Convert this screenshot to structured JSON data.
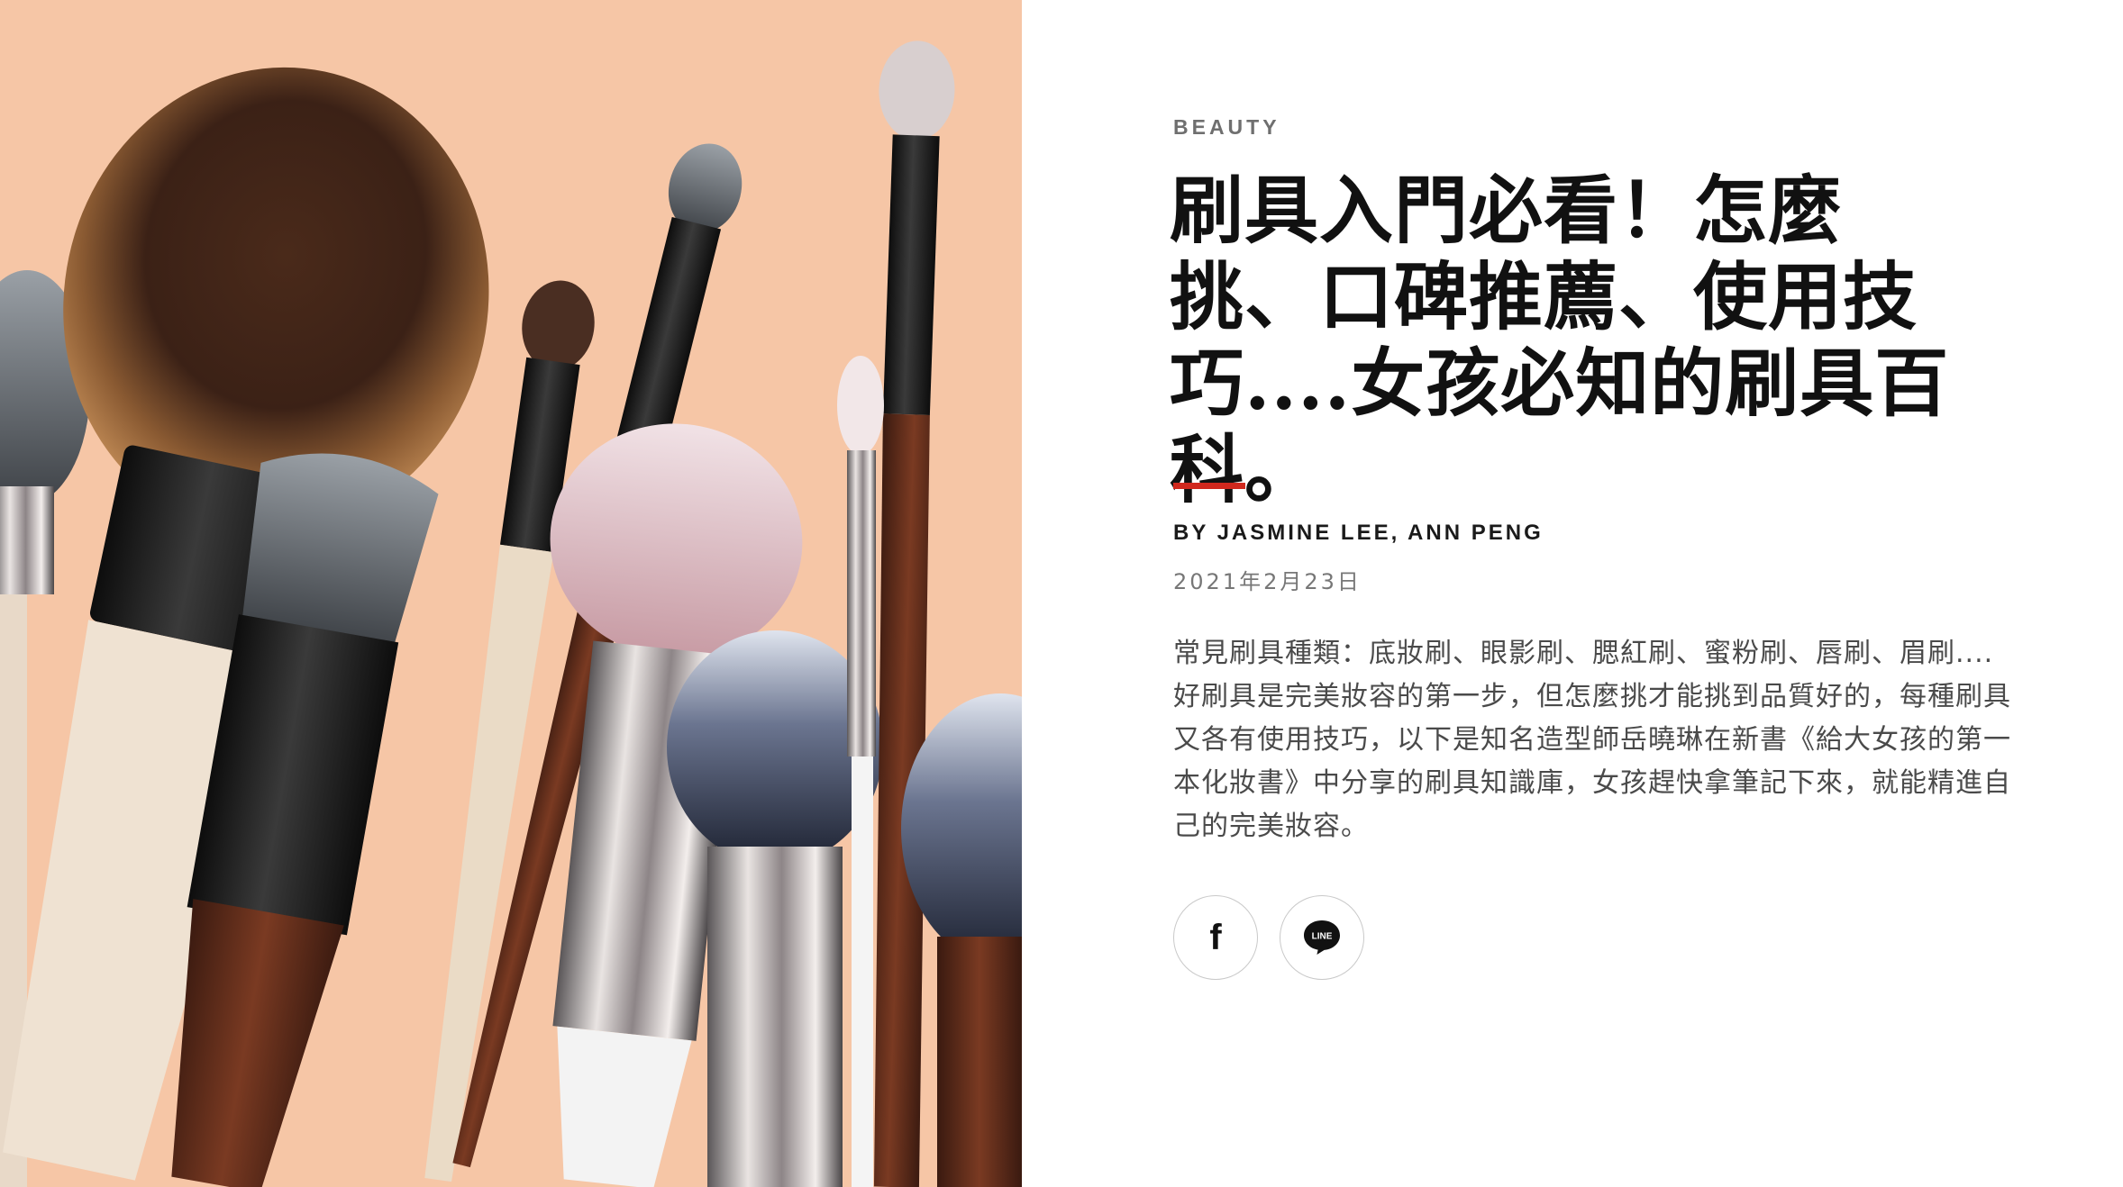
{
  "article": {
    "category": "BEAUTY",
    "title": "刷具入門必看！怎麼挑、口碑推薦、使用技巧....女孩必知的刷具百科。",
    "byline": "BY JASMINE LEE, ANN PENG",
    "date": "2021年2月23日",
    "summary": "常見刷具種類：底妝刷、眼影刷、腮紅刷、蜜粉刷、唇刷、眉刷....好刷具是完美妝容的第一步，但怎麼挑才能挑到品質好的，每種刷具又各有使用技巧，以下是知名造型師岳曉琳在新書《給大女孩的第一本化妝書》中分享的刷具知識庫，女孩趕快拿筆記下來，就能精進自己的完美妝容。"
  },
  "share": {
    "facebook_icon": "facebook-icon",
    "facebook_glyph": "f",
    "line_icon": "line-icon",
    "line_text": "LINE"
  },
  "hero": {
    "icon": "makeup-brushes-photo",
    "background_color": "#f6c6a6"
  },
  "colors": {
    "accent_rule": "#d0281d",
    "title": "#111111",
    "category": "#6f6f6f"
  }
}
